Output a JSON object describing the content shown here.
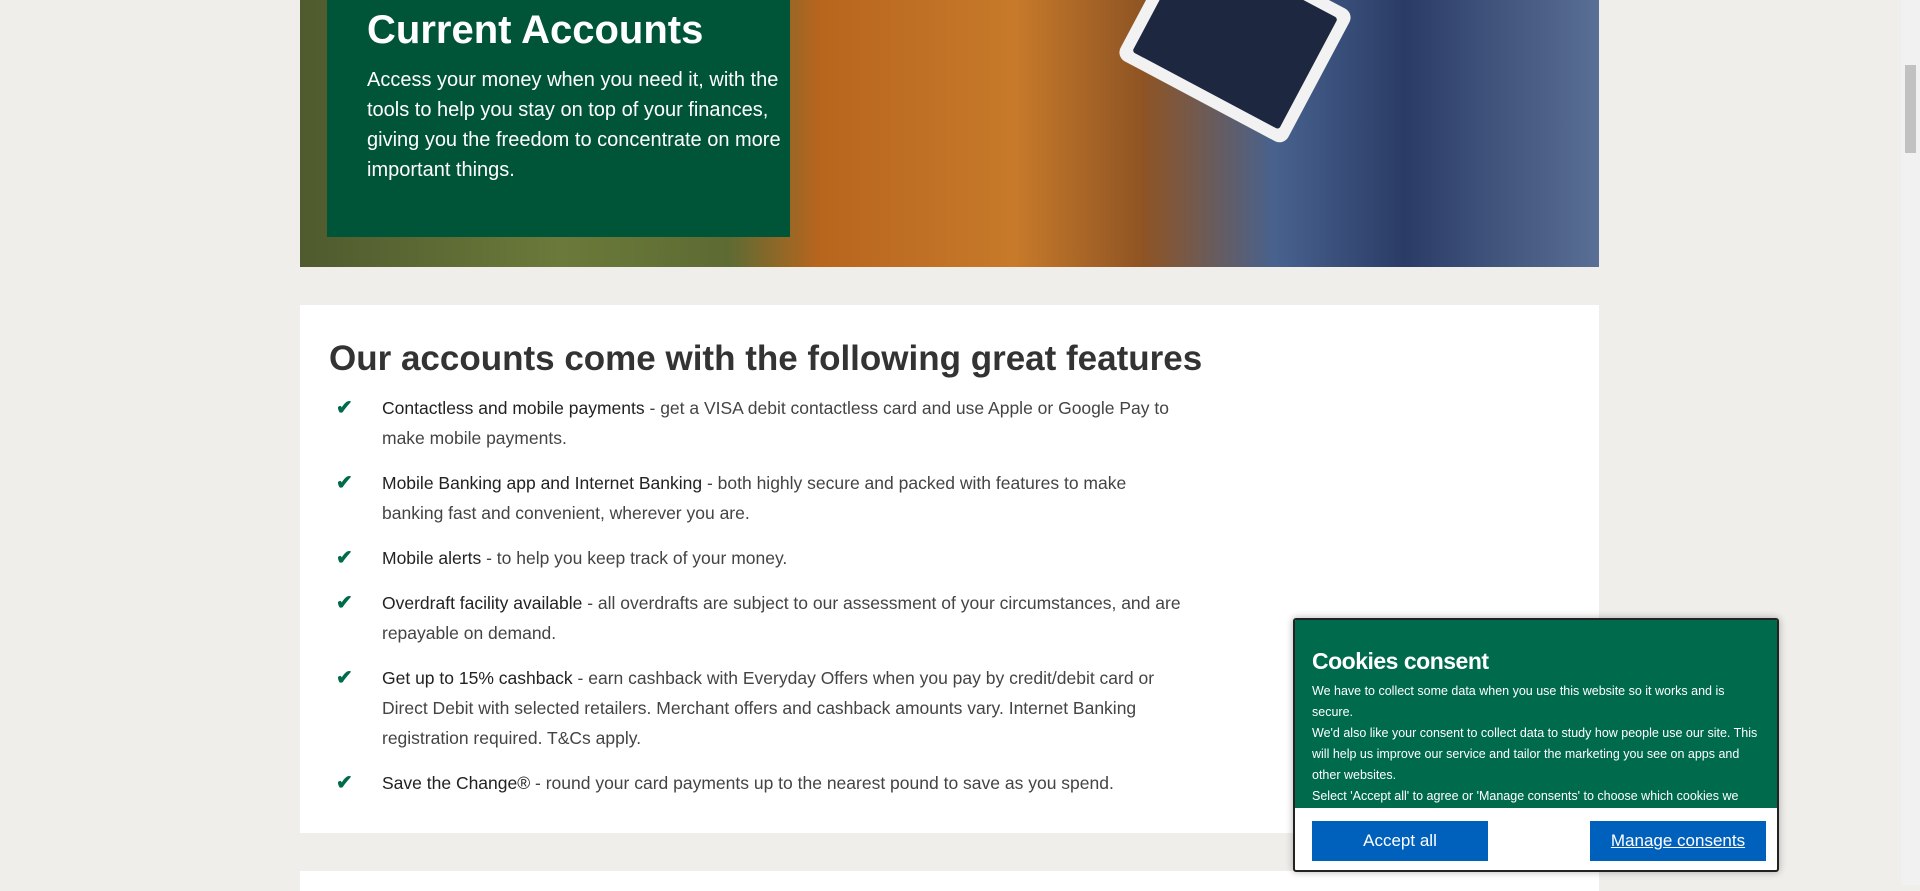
{
  "hero": {
    "title": "Current Accounts",
    "description": "Access your money when you need it, with the tools to help you stay on top of your finances, giving you the freedom to concentrate on more important things."
  },
  "features": {
    "heading": "Our accounts come with the following great features",
    "items": [
      {
        "title": "Contactless and mobile payments",
        "text": " - get a VISA debit contactless card and use Apple or Google Pay to make mobile payments."
      },
      {
        "title": "Mobile Banking app and Internet Banking",
        "text": " - both highly secure and packed with features to make banking fast and convenient, wherever you are."
      },
      {
        "title": "Mobile alerts",
        "text": " - to help you keep track of your money."
      },
      {
        "title": "Overdraft facility available",
        "text": " - all overdrafts are subject to our assessment of your circumstances, and are repayable on demand."
      },
      {
        "title": "Get up to 15% cashback",
        "text": " - earn cashback with Everyday Offers when you pay by credit/debit card or Direct Debit with selected retailers. Merchant offers and cashback amounts vary. Internet Banking registration required. T&Cs apply."
      },
      {
        "title": "Save the Change®",
        "text": " - round your card payments up to the nearest pound to save as you spend."
      }
    ]
  },
  "cookies": {
    "title": "Cookies consent",
    "lines": [
      "We have to collect some data when you use this website so it works and is secure.",
      "We'd also like your consent to collect data to study how people use our site. This will help us improve our service and tailor the marketing you see on apps and other websites.",
      "Select 'Accept all' to agree or 'Manage consents' to choose which cookies we use. You can change your mind by clicking the 'Cookies' link."
    ],
    "accept_label": "Accept all",
    "manage_label": "Manage consents"
  },
  "colors": {
    "brand_green": "#005438",
    "button_blue": "#0061bd"
  }
}
